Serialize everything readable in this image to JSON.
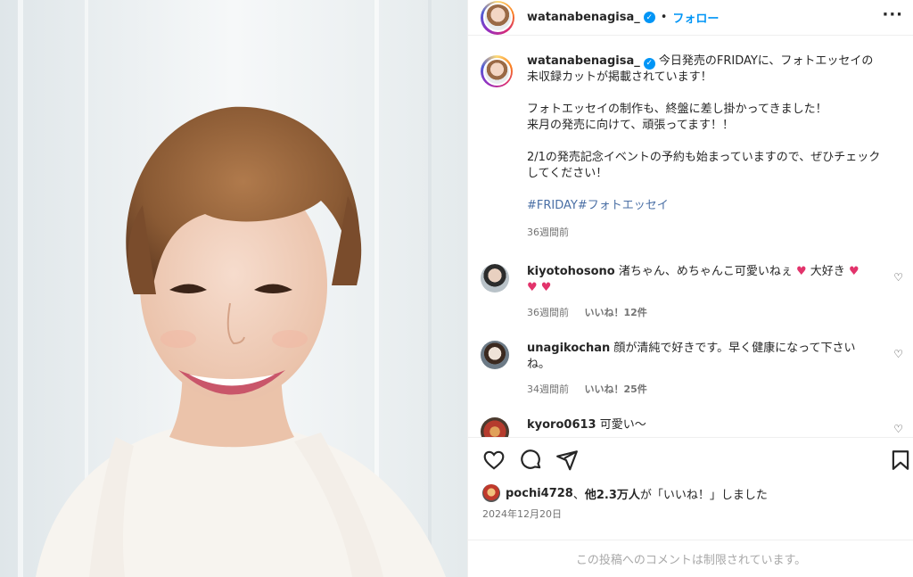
{
  "post": {
    "username": "watanabenagisa_",
    "separator": "•",
    "follow_label": "フォロー",
    "more_label": "···"
  },
  "caption": {
    "username": "watanabenagisa_",
    "paragraph1": "今日発売のFRIDAYに、フォトエッセイの未収録カットが掲載されています！",
    "paragraph2_line1": "フォトエッセイの制作も、終盤に差し掛かってきました！",
    "paragraph2_line2": "来月の発売に向けて、頑張ってます！！",
    "paragraph3": "2/1の発売記念イベントの予約も始まっていますので、ぜひチェックしてください！",
    "hashtag1": "#FRIDAY",
    "hashtag2": "#フォトエッセイ",
    "time": "36週間前"
  },
  "comments": [
    {
      "user": "kiyotohosono",
      "text": "渚ちゃん、めちゃんこ可愛いねぇ",
      "text_tail": "大好き",
      "time": "36週間前",
      "likes": "いいね！12件"
    },
    {
      "user": "unagikochan",
      "text": "顔が清純で好きです。早く健康になって下さいね。",
      "time": "34週間前",
      "likes": "いいね！25件"
    },
    {
      "user": "kyoro0613",
      "text": "可愛い〜"
    }
  ],
  "likes_summary": {
    "user": "pochi4728",
    "middle": "、",
    "others": "他2.3万人",
    "suffix": "が「いいね！」しました"
  },
  "date": "2024年12月20日",
  "restricted_notice": "この投稿へのコメントは制限されています。",
  "colors": {
    "accent": "#0095f6",
    "muted": "#737373",
    "heart_pink": "#e2336b"
  }
}
